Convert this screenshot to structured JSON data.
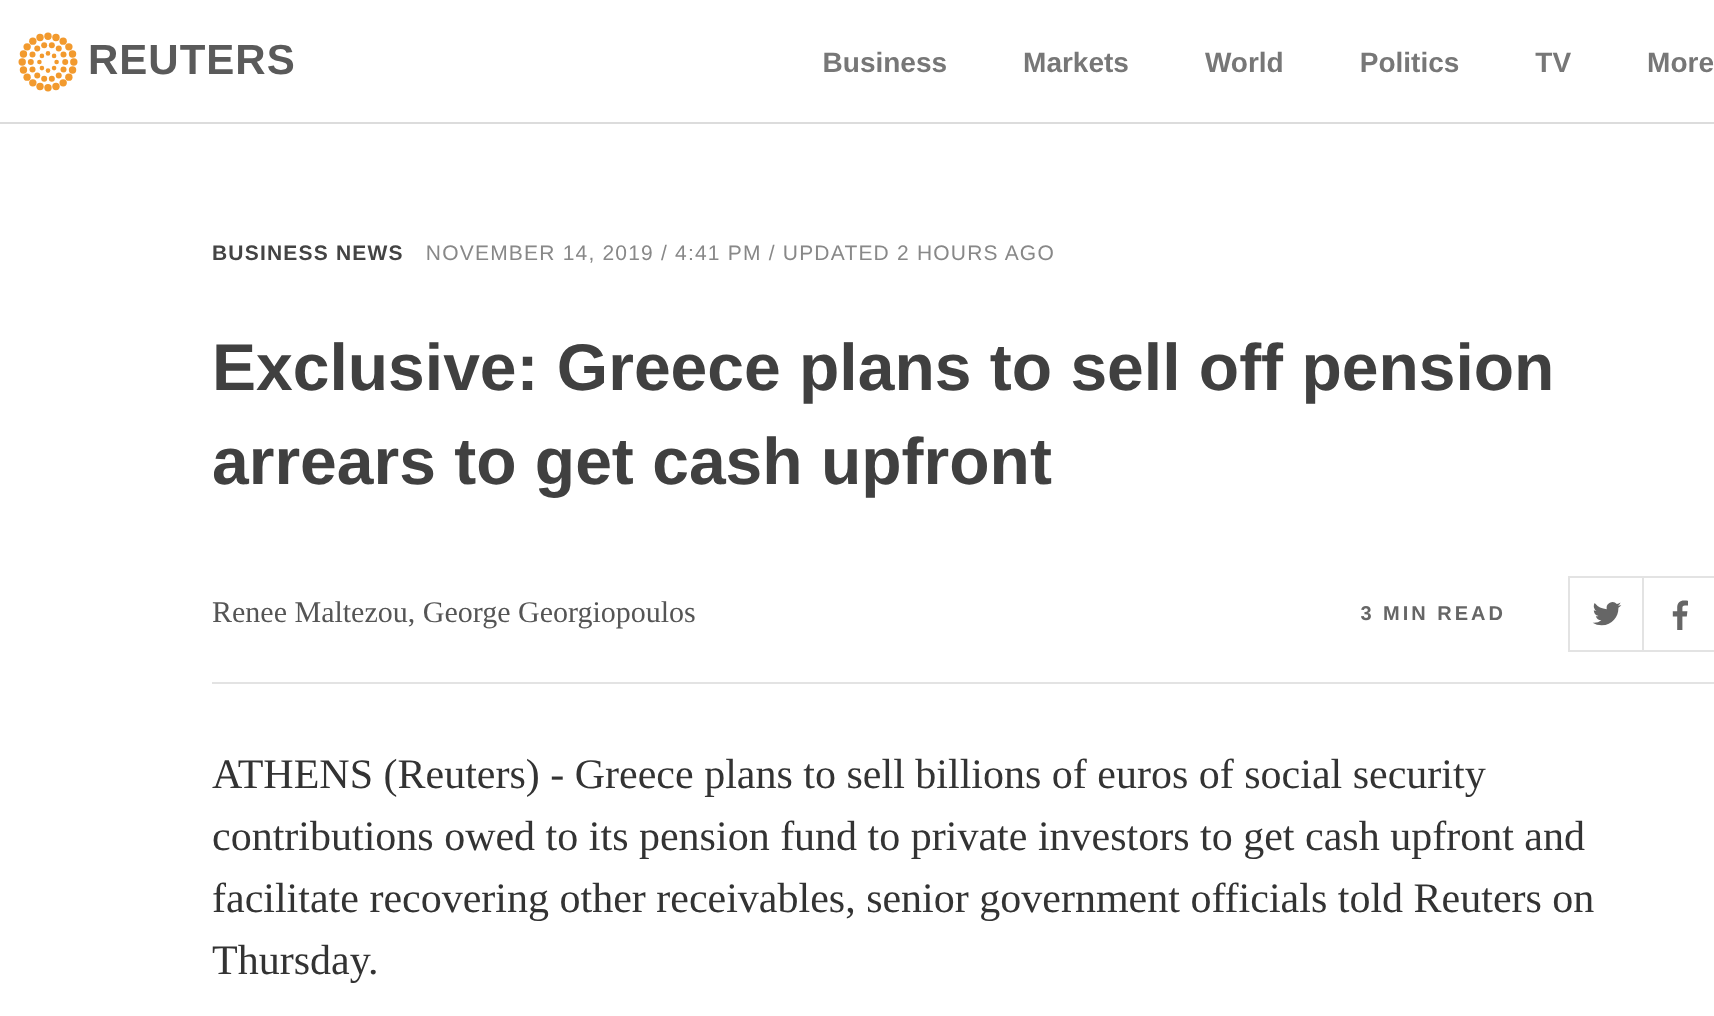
{
  "header": {
    "brand": "REUTERS",
    "nav": [
      {
        "label": "Business"
      },
      {
        "label": "Markets"
      },
      {
        "label": "World"
      },
      {
        "label": "Politics"
      },
      {
        "label": "TV"
      },
      {
        "label": "More"
      }
    ]
  },
  "article": {
    "section": "BUSINESS NEWS",
    "dateline": "NOVEMBER 14, 2019 / 4:41 PM / UPDATED 2 HOURS AGO",
    "headline": "Exclusive: Greece plans to sell off pension arrears to get cash upfront",
    "byline": "Renee Maltezou, George Georgiopoulos",
    "read_time": "3 MIN READ",
    "share": [
      {
        "kind": "twitter"
      },
      {
        "kind": "facebook"
      }
    ],
    "body": "ATHENS (Reuters) - Greece plans to sell billions of euros of social security contributions owed to its pension fund to private investors to get cash upfront and facilitate recovering other receivables, senior government officials told Reuters on Thursday."
  }
}
